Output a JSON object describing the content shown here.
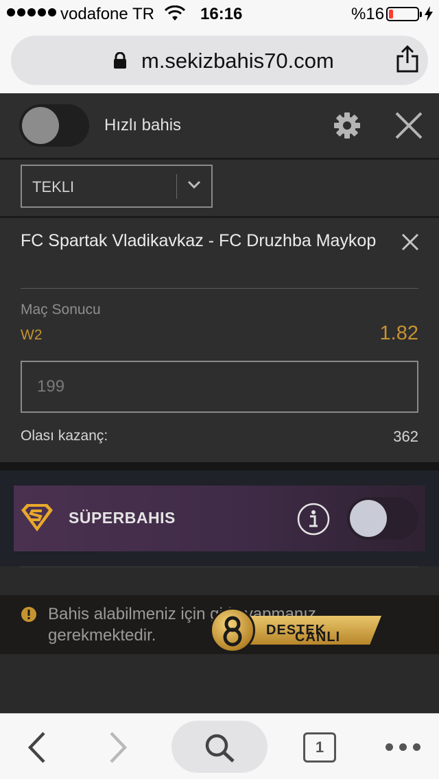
{
  "status_bar": {
    "carrier": "vodafone TR",
    "time": "16:16",
    "battery_percent": "%16",
    "battery_level": 0.16
  },
  "browser": {
    "url": "m.sekizbahis70.com",
    "open_tabs": "1"
  },
  "betslip": {
    "quick_bet_label": "Hızlı bahis",
    "quick_bet_enabled": false,
    "bet_type": "TEKLI",
    "bet": {
      "match": "FC Spartak Vladikavkaz - FC Druzhba Maykop",
      "market": "Maç Sonucu",
      "selection": "W2",
      "odds": "1.82",
      "stake_placeholder": "199",
      "possible_win_label": "Olası kazanç:",
      "possible_win_value": "362"
    },
    "superbahis": {
      "label": "SÜPERBAHIS",
      "enabled": false
    },
    "login_warning": "Bahis alabilmeniz için giriş yapmanız gerekmektedir."
  },
  "live_support": {
    "part1": "CANLI",
    "part2": "DESTEK"
  },
  "colors": {
    "accent_gold": "#c69331",
    "background": "#2e2e2e",
    "promo_purple": "#4a3150"
  }
}
